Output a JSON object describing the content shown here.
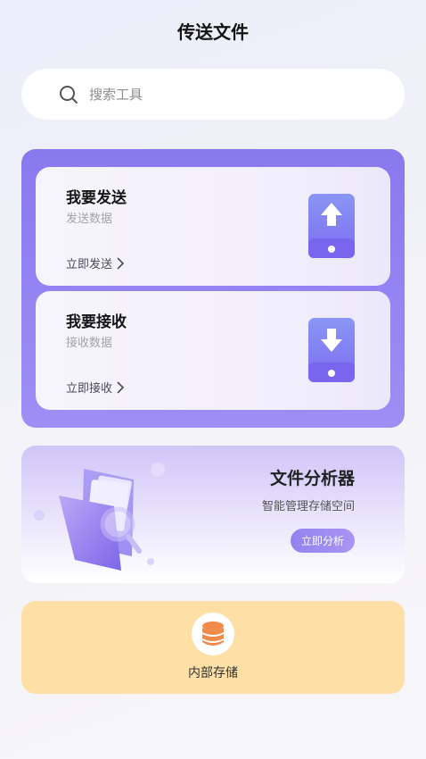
{
  "header": {
    "title": "传送文件"
  },
  "search": {
    "placeholder": "搜索工具",
    "icon": "search-icon"
  },
  "transfer": {
    "send": {
      "title": "我要发送",
      "subtitle": "发送数据",
      "action": "立即发送",
      "icon": "upload-phone-icon"
    },
    "receive": {
      "title": "我要接收",
      "subtitle": "接收数据",
      "action": "立即接收",
      "icon": "download-phone-icon"
    }
  },
  "analyzer": {
    "title": "文件分析器",
    "subtitle": "智能管理存储空间",
    "button": "立即分析",
    "icon": "folder-magnifier-icon"
  },
  "storage": {
    "label": "内部存储",
    "icon": "database-icon"
  },
  "colors": {
    "accent": "#8a78ef",
    "storage_bg": "#fedfa6",
    "storage_icon": "#f08a4b"
  }
}
